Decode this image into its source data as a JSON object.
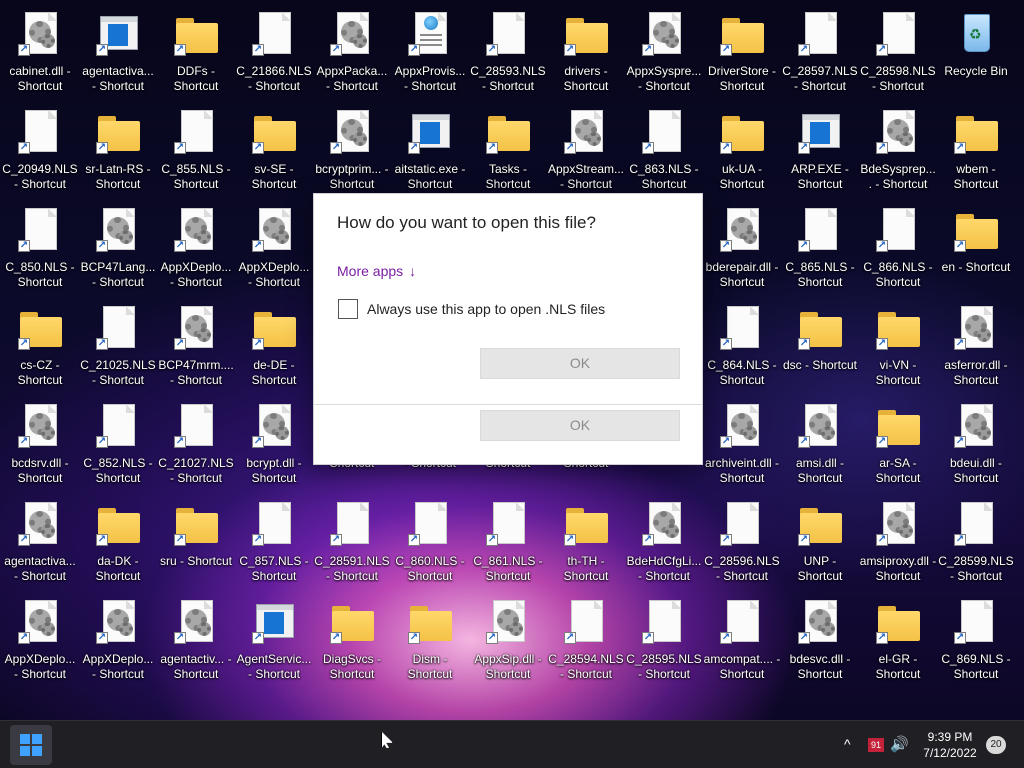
{
  "desktop": {
    "icons": [
      {
        "label": "cabinet.dll - Shortcut",
        "type": "gear"
      },
      {
        "label": "agentactiva... - Shortcut",
        "type": "app"
      },
      {
        "label": "DDFs - Shortcut",
        "type": "folder"
      },
      {
        "label": "C_21866.NLS - Shortcut",
        "type": "file"
      },
      {
        "label": "AppxPacka... - Shortcut",
        "type": "gear"
      },
      {
        "label": "AppxProvis... - Shortcut",
        "type": "web"
      },
      {
        "label": "C_28593.NLS - Shortcut",
        "type": "file"
      },
      {
        "label": "drivers - Shortcut",
        "type": "folder"
      },
      {
        "label": "AppxSyspre... - Shortcut",
        "type": "gear"
      },
      {
        "label": "DriverStore - Shortcut",
        "type": "folder"
      },
      {
        "label": "C_28597.NLS - Shortcut",
        "type": "file"
      },
      {
        "label": "C_28598.NLS - Shortcut",
        "type": "file"
      },
      {
        "label": "Recycle Bin",
        "type": "recycle"
      },
      {
        "label": "C_20949.NLS - Shortcut",
        "type": "file"
      },
      {
        "label": "sr-Latn-RS - Shortcut",
        "type": "folder"
      },
      {
        "label": "C_855.NLS - Shortcut",
        "type": "file"
      },
      {
        "label": "sv-SE - Shortcut",
        "type": "folder"
      },
      {
        "label": "bcryptprim... - Shortcut",
        "type": "gear"
      },
      {
        "label": "aitstatic.exe - Shortcut",
        "type": "app"
      },
      {
        "label": "Tasks - Shortcut",
        "type": "folder"
      },
      {
        "label": "AppxStream... - Shortcut",
        "type": "gear"
      },
      {
        "label": "C_863.NLS - Shortcut",
        "type": "file"
      },
      {
        "label": "uk-UA - Shortcut",
        "type": "folder"
      },
      {
        "label": "ARP.EXE - Shortcut",
        "type": "app"
      },
      {
        "label": "BdeSysprep.... - Shortcut",
        "type": "gear"
      },
      {
        "label": "wbem - Shortcut",
        "type": "folder"
      },
      {
        "label": "C_850.NLS - Shortcut",
        "type": "file"
      },
      {
        "label": "BCP47Lang... - Shortcut",
        "type": "gear"
      },
      {
        "label": "AppXDeplo... - Shortcut",
        "type": "gear"
      },
      {
        "label": "AppXDeplo... - Shortcut",
        "type": "gear"
      },
      {
        "label": "bderepair.dll - Shortcut",
        "type": "gear"
      },
      {
        "label": "C_865.NLS - Shortcut",
        "type": "file"
      },
      {
        "label": "C_866.NLS - Shortcut",
        "type": "file"
      },
      {
        "label": "en - Shortcut",
        "type": "folder"
      },
      {
        "label": "cs-CZ - Shortcut",
        "type": "folder"
      },
      {
        "label": "C_21025.NLS - Shortcut",
        "type": "file"
      },
      {
        "label": "BCP47mrm.... - Shortcut",
        "type": "gear"
      },
      {
        "label": "de-DE - Shortcut",
        "type": "folder"
      },
      {
        "label": "C_864.NLS - Shortcut",
        "type": "file"
      },
      {
        "label": "dsc - Shortcut",
        "type": "folder"
      },
      {
        "label": "vi-VN - Shortcut",
        "type": "folder"
      },
      {
        "label": "asferror.dll - Shortcut",
        "type": "gear"
      },
      {
        "label": "bcdsrv.dll - Shortcut",
        "type": "gear"
      },
      {
        "label": "C_852.NLS - Shortcut",
        "type": "file"
      },
      {
        "label": "C_21027.NLS - Shortcut",
        "type": "file"
      },
      {
        "label": "bcrypt.dll - Shortcut",
        "type": "gear"
      },
      {
        "label": "Shortcut",
        "type": "none"
      },
      {
        "label": "- Shortcut",
        "type": "none"
      },
      {
        "label": "Shortcut",
        "type": "none"
      },
      {
        "label": "Shortcut",
        "type": "none"
      },
      {
        "label": "archiveint.dll - Shortcut",
        "type": "gear"
      },
      {
        "label": "amsi.dll - Shortcut",
        "type": "gear"
      },
      {
        "label": "ar-SA - Shortcut",
        "type": "folder"
      },
      {
        "label": "bdeui.dll - Shortcut",
        "type": "gear"
      },
      {
        "label": "agentactiva... - Shortcut",
        "type": "gear"
      },
      {
        "label": "da-DK - Shortcut",
        "type": "folder"
      },
      {
        "label": "sru - Shortcut",
        "type": "folder"
      },
      {
        "label": "C_857.NLS - Shortcut",
        "type": "file"
      },
      {
        "label": "C_28591.NLS - Shortcut",
        "type": "file"
      },
      {
        "label": "C_860.NLS - Shortcut",
        "type": "file"
      },
      {
        "label": "C_861.NLS - Shortcut",
        "type": "file"
      },
      {
        "label": "th-TH - Shortcut",
        "type": "folder"
      },
      {
        "label": "BdeHdCfgLi... - Shortcut",
        "type": "gear"
      },
      {
        "label": "C_28596.NLS - Shortcut",
        "type": "file"
      },
      {
        "label": "UNP - Shortcut",
        "type": "folder"
      },
      {
        "label": "amsiproxy.dll - Shortcut",
        "type": "gear"
      },
      {
        "label": "C_28599.NLS - Shortcut",
        "type": "file"
      },
      {
        "label": "AppXDeplo... - Shortcut",
        "type": "gear"
      },
      {
        "label": "AppXDeplo... - Shortcut",
        "type": "gear"
      },
      {
        "label": "agentactiv... - Shortcut",
        "type": "gear"
      },
      {
        "label": "AgentServic... - Shortcut",
        "type": "app"
      },
      {
        "label": "DiagSvcs - Shortcut",
        "type": "folder"
      },
      {
        "label": "Dism - Shortcut",
        "type": "folder"
      },
      {
        "label": "AppxSip.dll - Shortcut",
        "type": "gear"
      },
      {
        "label": "C_28594.NLS - Shortcut",
        "type": "file"
      },
      {
        "label": "C_28595.NLS - Shortcut",
        "type": "file"
      },
      {
        "label": "amcompat.... - Shortcut",
        "type": "file"
      },
      {
        "label": "bdesvc.dll - Shortcut",
        "type": "gear"
      },
      {
        "label": "el-GR - Shortcut",
        "type": "folder"
      },
      {
        "label": "C_869.NLS - Shortcut",
        "type": "file"
      }
    ]
  },
  "dialog": {
    "title": "How do you want to open this file?",
    "more_apps": "More apps",
    "more_apps_arrow": "↓",
    "always_label": "Always use this app to open .NLS files",
    "always_checked": false,
    "ok_label_1": "OK",
    "ok_label_2": "OK"
  },
  "taskbar": {
    "tray_chevron": "^",
    "tray_badge": "91",
    "volume_icon": "🔊",
    "time": "9:39 PM",
    "date": "7/12/2022",
    "notifications": "20"
  }
}
